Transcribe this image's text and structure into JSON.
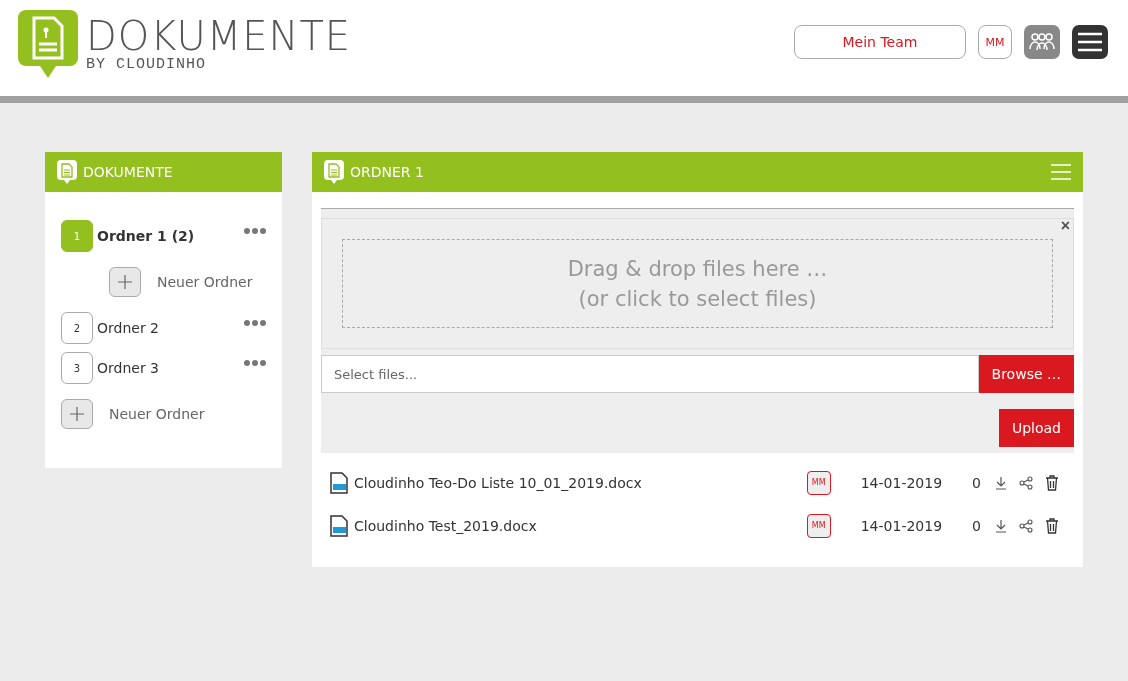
{
  "header": {
    "logo_title": "DOKUMENTE",
    "logo_subtitle": "BY CLOUDINHO",
    "team_button": "Mein Team",
    "user_initials": "MM"
  },
  "sidebar": {
    "title": "DOKUMENTE",
    "folders": [
      {
        "number": "1",
        "label": "Ordner 1 (2)",
        "selected": true,
        "children": [
          {
            "kind": "add",
            "label": "Neuer Ordner"
          }
        ]
      },
      {
        "number": "2",
        "label": "Ordner 2",
        "selected": false
      },
      {
        "number": "3",
        "label": "Ordner 3",
        "selected": false
      }
    ],
    "add_label": "Neuer Ordner"
  },
  "main": {
    "title": "ORDNER 1",
    "close_icon": "×",
    "dropzone": [
      "Drag & drop files here …",
      "(or click to select files)"
    ],
    "file_input": {
      "placeholder": "Select files..."
    },
    "browse_button": "Browse …",
    "upload_button": "Upload",
    "files": [
      {
        "name": "Cloudinho Teo-Do Liste 10_01_2019.docx",
        "owner": "MM",
        "date": "14-01-2019",
        "downloads": "0"
      },
      {
        "name": "Cloudinho Test_2019.docx",
        "owner": "MM",
        "date": "14-01-2019",
        "downloads": "0"
      }
    ]
  }
}
